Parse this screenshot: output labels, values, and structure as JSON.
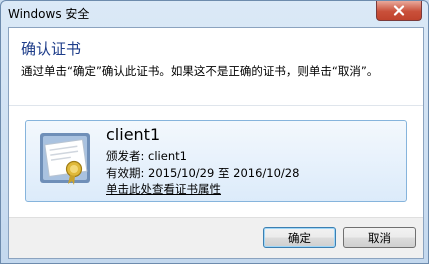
{
  "window": {
    "title": "Windows 安全"
  },
  "dialog": {
    "heading": "确认证书",
    "description": "通过单击“确定”确认此证书。如果这不是正确的证书，则单击“取消”。"
  },
  "certificate": {
    "name": "client1",
    "issuer": "颁发者: client1",
    "validity": "有效期: 2015/10/29 至 2016/10/28",
    "link": "单击此处查看证书属性"
  },
  "buttons": {
    "ok": "确定",
    "cancel": "取消"
  },
  "icons": {
    "close": "close-icon",
    "certificate": "certificate-icon"
  },
  "colors": {
    "heading": "#1e3d8a",
    "close_button": "#c9503a",
    "cert_box_border": "#86b4dc"
  }
}
